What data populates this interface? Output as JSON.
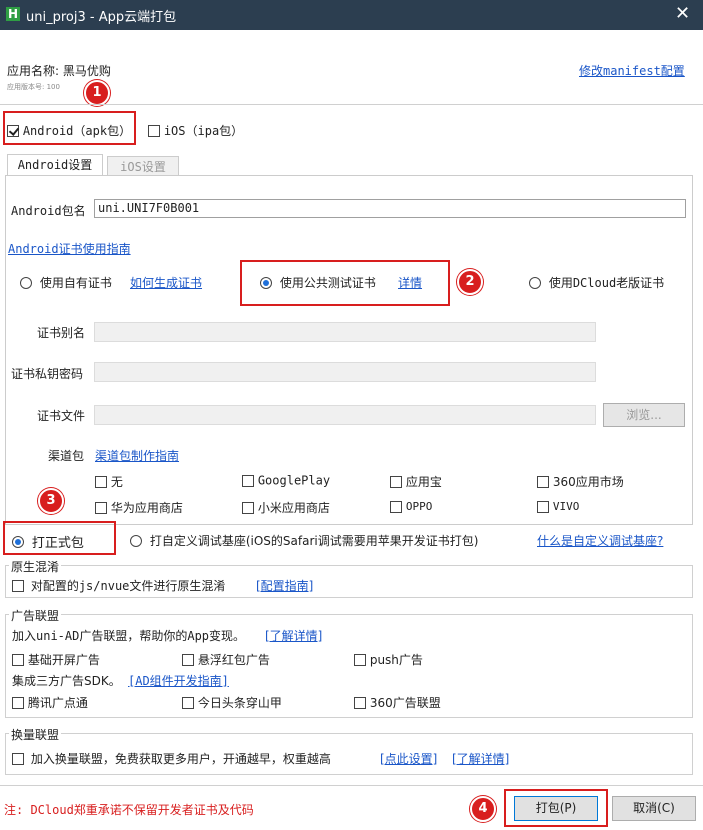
{
  "window": {
    "title": "uni_proj3 - App云端打包",
    "icon_letter": "H",
    "close_glyph": "✕"
  },
  "app": {
    "name_label": "应用名称: 黑马优购",
    "version_label": "应用版本号: 100",
    "manifest_link": "修改manifest配置"
  },
  "platforms": {
    "android": {
      "label": "Android（apk包）",
      "checked": true
    },
    "ios": {
      "label": "iOS（ipa包）",
      "checked": false
    }
  },
  "tabs": [
    {
      "label": "Android设置",
      "active": true
    },
    {
      "label": "iOS设置",
      "active": false
    }
  ],
  "android": {
    "package_label": "Android包名",
    "package_value": "uni.UNI7F0B001",
    "cert_guide_link": "Android证书使用指南",
    "cert_options": {
      "own": {
        "label": "使用自有证书",
        "link": "如何生成证书",
        "selected": false
      },
      "public": {
        "label": "使用公共测试证书",
        "link": "详情",
        "selected": true
      },
      "dcloud": {
        "label": "使用DCloud老版证书",
        "selected": false
      }
    },
    "alias_label": "证书别名",
    "password_label": "证书私钥密码",
    "file_label": "证书文件",
    "browse_label": "浏览...",
    "channel_label": "渠道包",
    "channel_link": "渠道包制作指南",
    "channels": [
      {
        "label": "无"
      },
      {
        "label": "GooglePlay"
      },
      {
        "label": "应用宝"
      },
      {
        "label": "360应用市场"
      },
      {
        "label": "华为应用商店"
      },
      {
        "label": "小米应用商店"
      },
      {
        "label": "OPPO"
      },
      {
        "label": "VIVO"
      }
    ]
  },
  "build_type": {
    "formal": {
      "label": "打正式包",
      "selected": true
    },
    "custom": {
      "label": "打自定义调试基座(iOS的Safari调试需要用苹果开发证书打包)",
      "selected": false
    },
    "custom_link": "什么是自定义调试基座?"
  },
  "obfuscation": {
    "title": "原生混淆",
    "option": "对配置的js/nvue文件进行原生混淆",
    "link": "[配置指南]"
  },
  "ads": {
    "title": "广告联盟",
    "intro": "加入uni-AD广告联盟，帮助你的App变现。",
    "intro_link": "[了解详情]",
    "options1": [
      {
        "label": "基础开屏广告"
      },
      {
        "label": "悬浮红包广告"
      },
      {
        "label": "push广告"
      }
    ],
    "sdk_text": "集成三方广告SDK。",
    "sdk_link": "[AD组件开发指南]",
    "options2": [
      {
        "label": "腾讯广点通"
      },
      {
        "label": "今日头条穿山甲"
      },
      {
        "label": "360广告联盟"
      }
    ]
  },
  "exchange": {
    "title": "换量联盟",
    "option": "加入换量联盟，免费获取更多用户，开通越早，权重越高",
    "link1": "[点此设置]",
    "link2": "[了解详情]"
  },
  "footer": {
    "note": "注: DCloud郑重承诺不保留开发者证书及代码",
    "pack_button": "打包(P)",
    "cancel_button": "取消(C)"
  },
  "badges": [
    "1",
    "2",
    "3",
    "4"
  ],
  "colors": {
    "highlight": "#d81e1e",
    "link": "#1a56c8",
    "titlebar": "#2c3e50",
    "note": "#d81e1e"
  }
}
